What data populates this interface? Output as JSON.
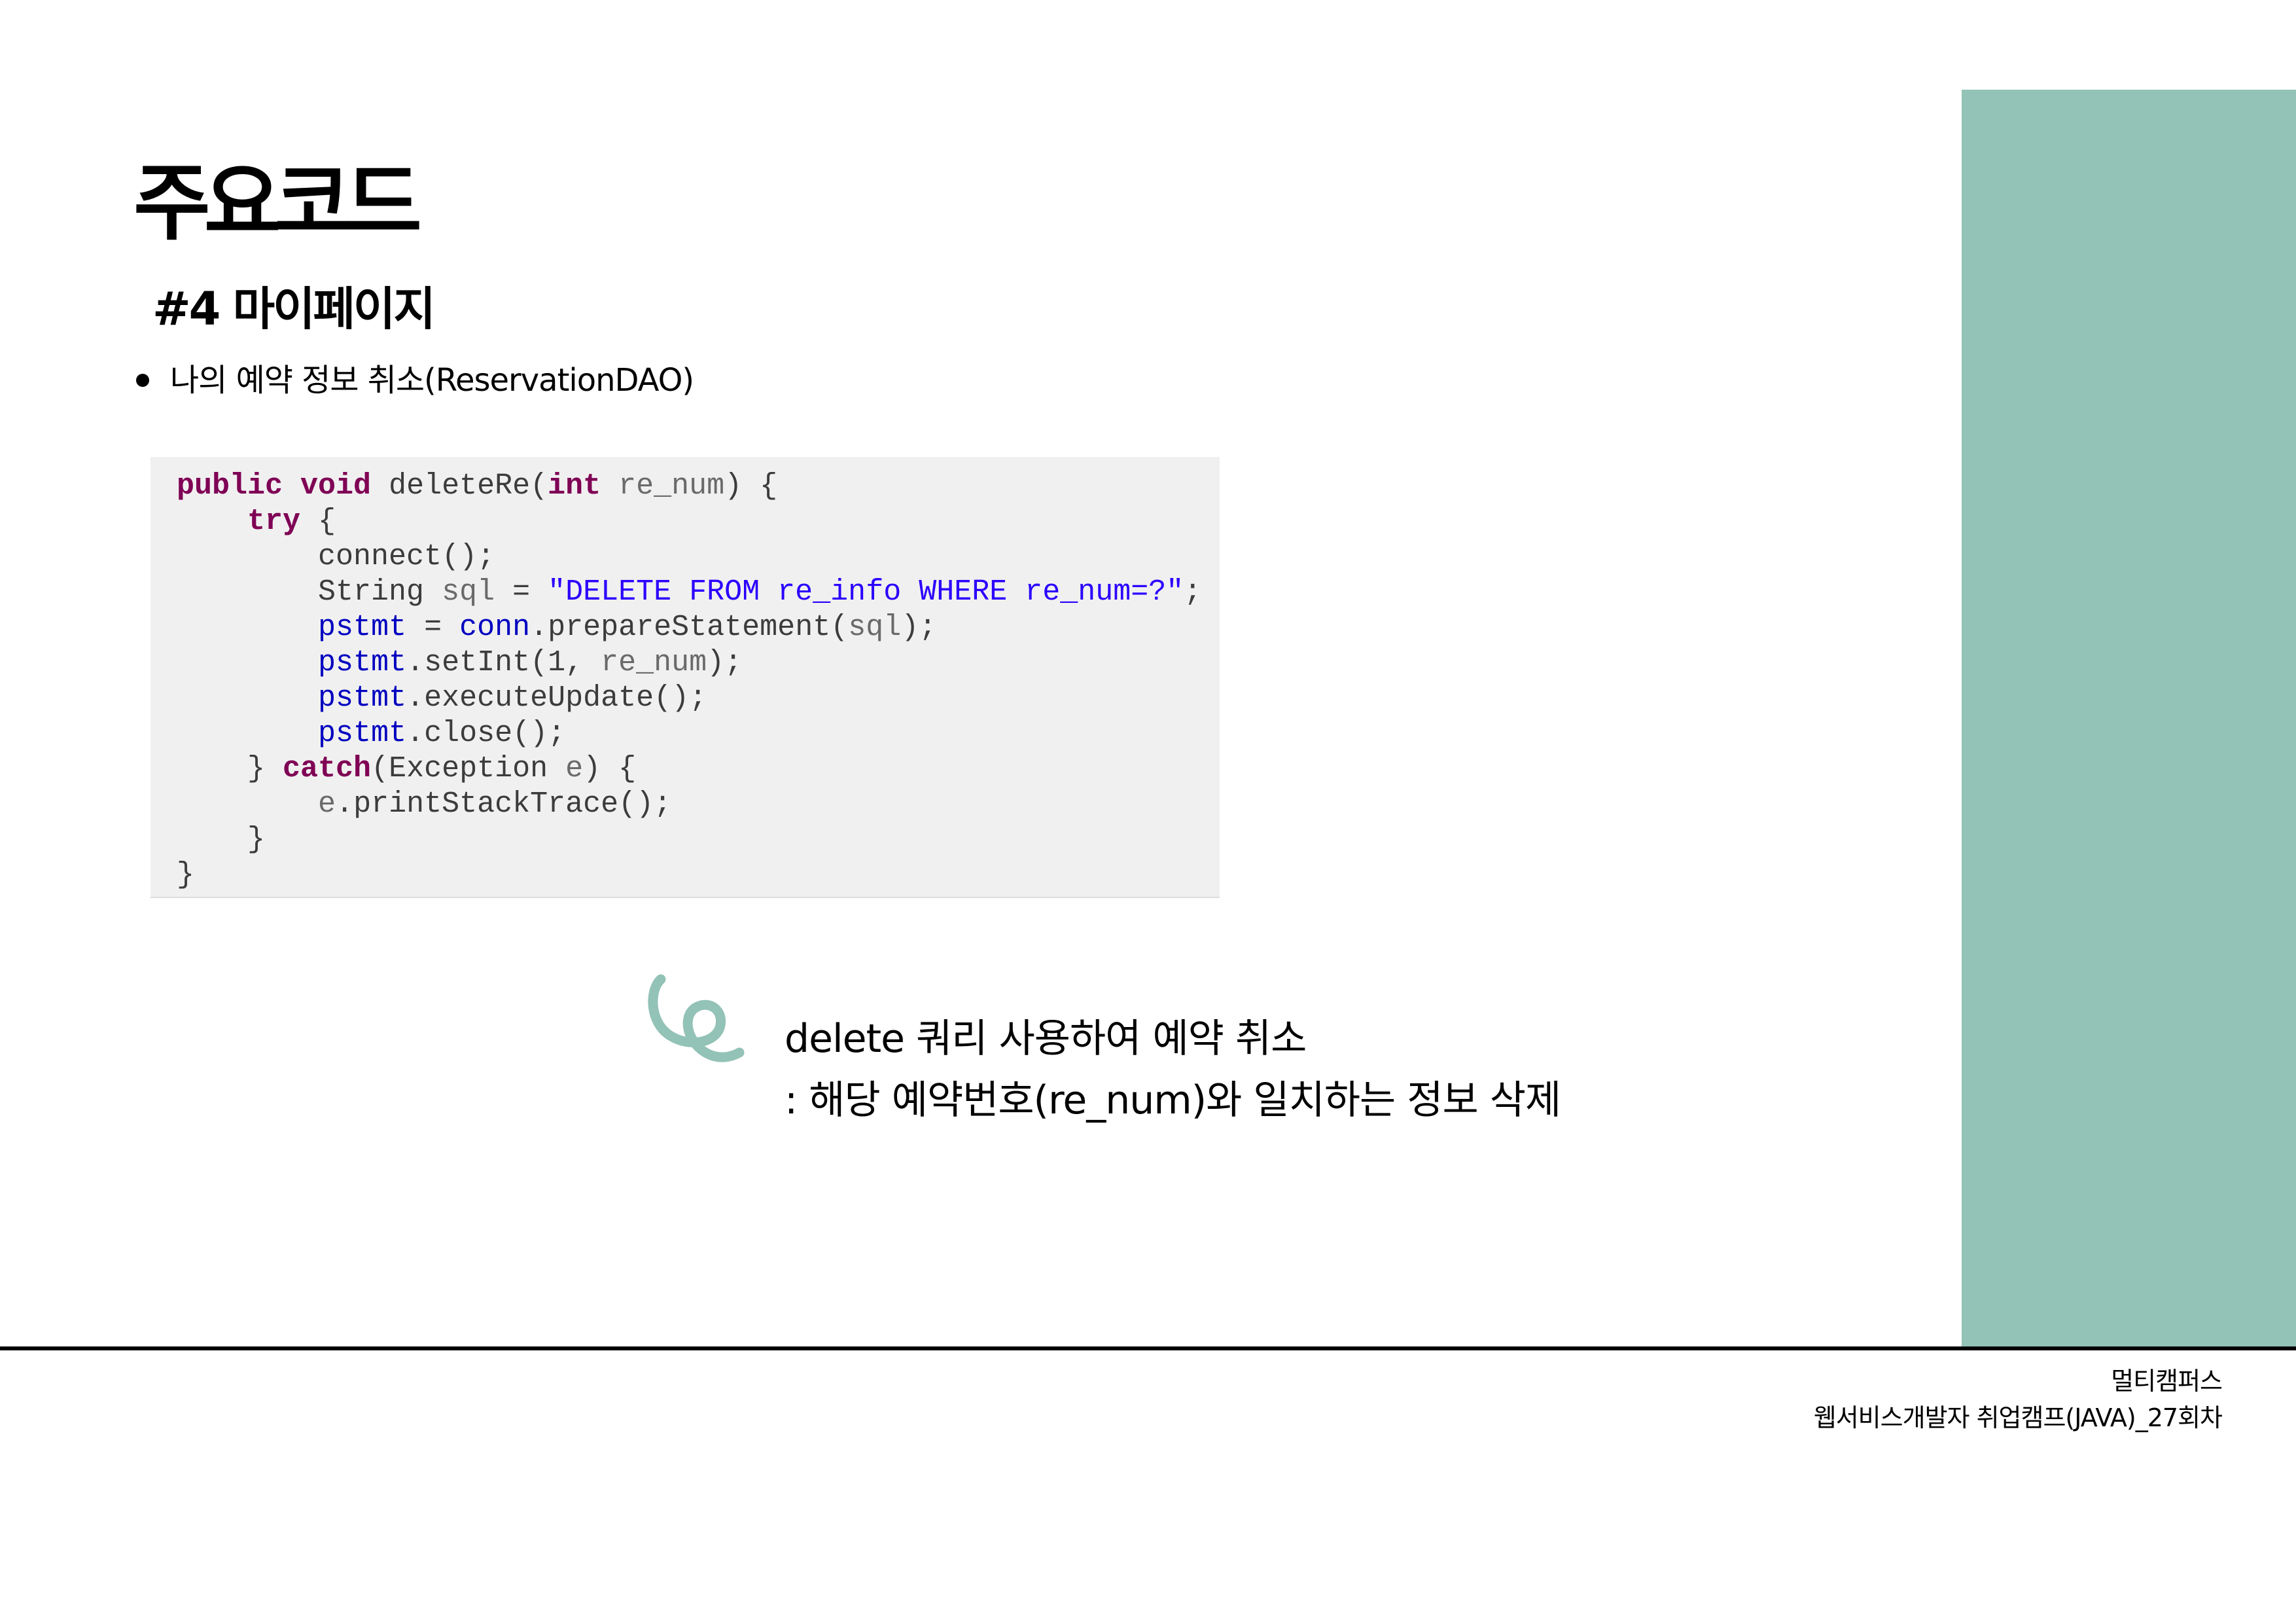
{
  "slide": {
    "title": "주요코드",
    "section": "#4 마이페이지",
    "bullet": "나의 예약 정보 취소(ReservationDAO)"
  },
  "code": {
    "lines": [
      [
        {
          "t": "public void",
          "k": "kw"
        },
        {
          "t": " deleteRe(",
          "k": "plain"
        },
        {
          "t": "int",
          "k": "kw"
        },
        {
          "t": " re_num",
          "k": "var"
        },
        {
          "t": ") {",
          "k": "plain"
        }
      ],
      [
        {
          "t": "    ",
          "k": "plain"
        },
        {
          "t": "try",
          "k": "kw"
        },
        {
          "t": " {",
          "k": "plain"
        }
      ],
      [
        {
          "t": "        connect();",
          "k": "plain"
        }
      ],
      [
        {
          "t": "        String ",
          "k": "plain"
        },
        {
          "t": "sql",
          "k": "var"
        },
        {
          "t": " = ",
          "k": "plain"
        },
        {
          "t": "\"DELETE FROM re_info WHERE re_num=?\"",
          "k": "str"
        },
        {
          "t": ";",
          "k": "plain"
        }
      ],
      [
        {
          "t": "        ",
          "k": "plain"
        },
        {
          "t": "pstmt",
          "k": "field"
        },
        {
          "t": " = ",
          "k": "plain"
        },
        {
          "t": "conn",
          "k": "field"
        },
        {
          "t": ".prepareStatement(",
          "k": "plain"
        },
        {
          "t": "sql",
          "k": "var"
        },
        {
          "t": ");",
          "k": "plain"
        }
      ],
      [
        {
          "t": "        ",
          "k": "plain"
        },
        {
          "t": "pstmt",
          "k": "field"
        },
        {
          "t": ".setInt(1, ",
          "k": "plain"
        },
        {
          "t": "re_num",
          "k": "var"
        },
        {
          "t": ");",
          "k": "plain"
        }
      ],
      [
        {
          "t": "        ",
          "k": "plain"
        },
        {
          "t": "pstmt",
          "k": "field"
        },
        {
          "t": ".executeUpdate();",
          "k": "plain"
        }
      ],
      [
        {
          "t": "        ",
          "k": "plain"
        },
        {
          "t": "pstmt",
          "k": "field"
        },
        {
          "t": ".close();",
          "k": "plain"
        }
      ],
      [
        {
          "t": "    } ",
          "k": "plain"
        },
        {
          "t": "catch",
          "k": "kw"
        },
        {
          "t": "(Exception ",
          "k": "plain"
        },
        {
          "t": "e",
          "k": "var"
        },
        {
          "t": ") {",
          "k": "plain"
        }
      ],
      [
        {
          "t": "        ",
          "k": "plain"
        },
        {
          "t": "e",
          "k": "var"
        },
        {
          "t": ".printStackTrace();",
          "k": "plain"
        }
      ],
      [
        {
          "t": "    }",
          "k": "plain"
        }
      ],
      [
        {
          "t": "}",
          "k": "plain"
        }
      ]
    ]
  },
  "note": {
    "line1": "delete 쿼리 사용하여 예약 취소",
    "line2": ": 해당 예약번호(re_num)와 일치하는 정보 삭제"
  },
  "footer": {
    "line1": "멀티캠퍼스",
    "line2": "웹서비스개발자 취업캠프(JAVA)_27회차"
  },
  "colors": {
    "side_panel": "#93c2b6",
    "code_background": "#f0f0f0",
    "keyword": "#7f0055",
    "string": "#2a00ff",
    "field": "#0000c0",
    "variable": "#6a6a6a"
  },
  "icons": {
    "swirl": "swirl-e-icon"
  }
}
